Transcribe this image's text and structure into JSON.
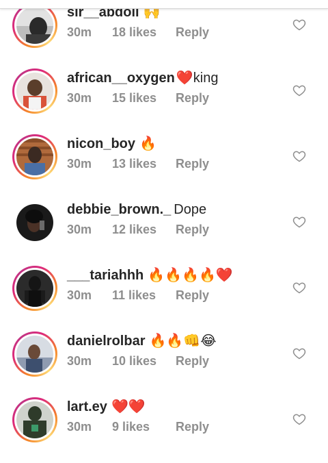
{
  "comments": [
    {
      "username": "sir__abdoll",
      "text": "",
      "emoji": "🙌",
      "time": "30m",
      "likes": "18 likes",
      "reply": "Reply",
      "avatar": "ring"
    },
    {
      "username": "african__oxygen",
      "text": "king",
      "emoji": "❤️",
      "time": "30m",
      "likes": "15 likes",
      "reply": "Reply",
      "avatar": "ring"
    },
    {
      "username": "nicon_boy",
      "text": "",
      "emoji": "🔥",
      "time": "30m",
      "likes": "13 likes",
      "reply": "Reply",
      "avatar": "ring"
    },
    {
      "username": "debbie_brown._",
      "text": "Dope",
      "emoji": "",
      "time": "30m",
      "likes": "12 likes",
      "reply": "Reply",
      "avatar": "plain"
    },
    {
      "username": "___tariahhh",
      "text": "",
      "emoji": "🔥🔥🔥🔥❤️",
      "time": "30m",
      "likes": "11 likes",
      "reply": "Reply",
      "avatar": "ring"
    },
    {
      "username": "danielrolbar",
      "text": "",
      "emoji": "🔥🔥👊😂",
      "time": "30m",
      "likes": "10 likes",
      "reply": "Reply",
      "avatar": "ring"
    },
    {
      "username": "lart.ey",
      "text": "",
      "emoji": "❤️❤️",
      "time": "30m",
      "likes": "9 likes",
      "reply": "Reply",
      "avatar": "ring"
    }
  ],
  "icons": {
    "like": "heart-outline-icon"
  },
  "colors": {
    "username": "#262626",
    "meta": "#8e8e8e",
    "heart_outline": "#8e8e8e",
    "ring_start": "#f58529",
    "ring_end": "#c13584"
  }
}
